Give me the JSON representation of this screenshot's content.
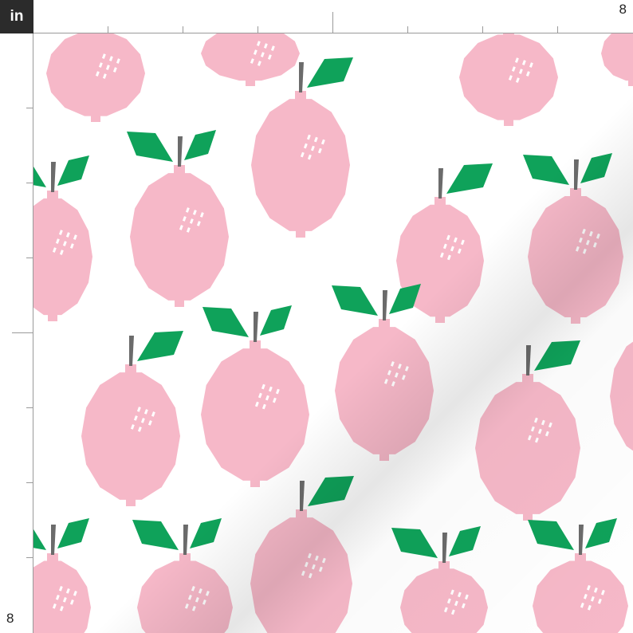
{
  "ruler": {
    "unit_label": "in",
    "top_end_label": "8",
    "left_end_label": "8"
  },
  "pattern": {
    "motif": "lemon",
    "colors": {
      "background": "#ffffff",
      "fruit": "#f6b8c8",
      "leaf": "#0fa25a",
      "stem": "#6b6b6b",
      "highlight": "#ffffff",
      "fabric_shadow": "#8a8a8a"
    }
  }
}
